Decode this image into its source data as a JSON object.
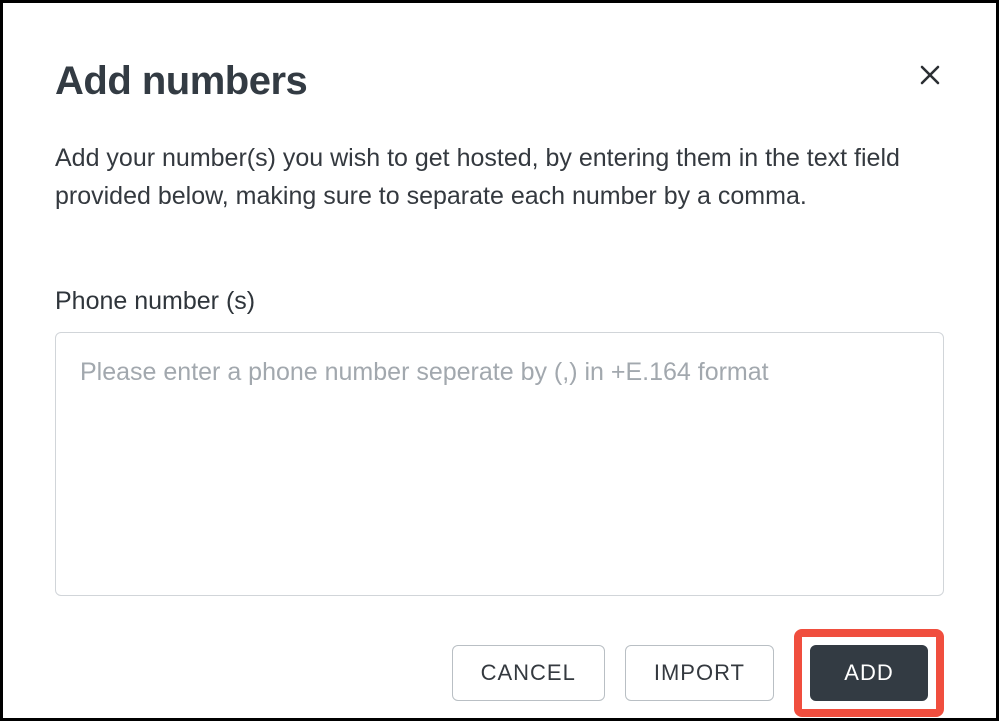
{
  "dialog": {
    "title": "Add numbers",
    "description": "Add your number(s) you wish to get hosted, by entering them in the text field provided below, making sure to separate each number by a comma."
  },
  "field": {
    "label": "Phone number (s)",
    "placeholder": "Please enter a phone number seperate by (,) in +E.164 format",
    "value": ""
  },
  "buttons": {
    "cancel": "CANCEL",
    "import": "IMPORT",
    "add": "ADD"
  }
}
